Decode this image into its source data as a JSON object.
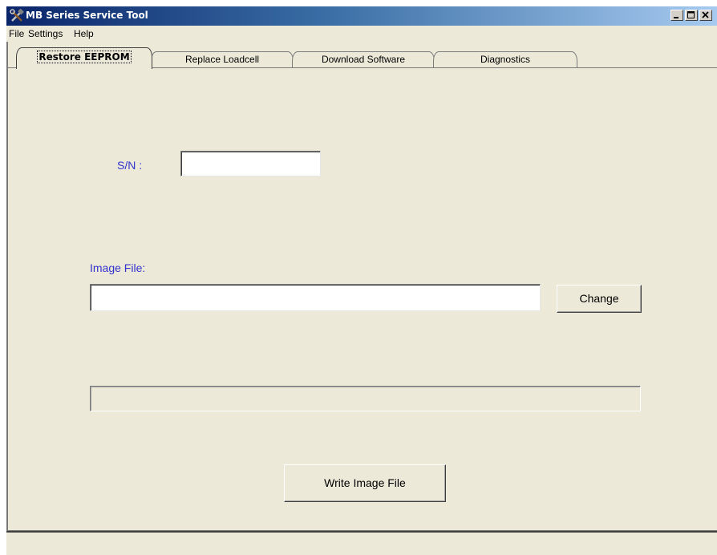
{
  "window": {
    "title": "MB Series Service Tool",
    "icon": "tools-icon",
    "caption_buttons": [
      "minimize",
      "maximize",
      "close"
    ]
  },
  "menu": {
    "items": [
      "File",
      "Settings",
      "Help"
    ]
  },
  "tabs": {
    "items": [
      {
        "label": "Restore EEPROM",
        "active": true
      },
      {
        "label": "Replace Loadcell",
        "active": false
      },
      {
        "label": "Download Software",
        "active": false
      },
      {
        "label": "Diagnostics",
        "active": false
      }
    ]
  },
  "restore": {
    "sn_label": "S/N :",
    "sn_value": "",
    "image_file_label": "Image File:",
    "image_file_value": "",
    "change_button": "Change",
    "progress": 0,
    "write_button": "Write Image File"
  },
  "colors": {
    "label_blue": "#3333cc",
    "titlebar_start": "#0a246a",
    "titlebar_end": "#a6caf0",
    "face": "#ece9d8"
  }
}
